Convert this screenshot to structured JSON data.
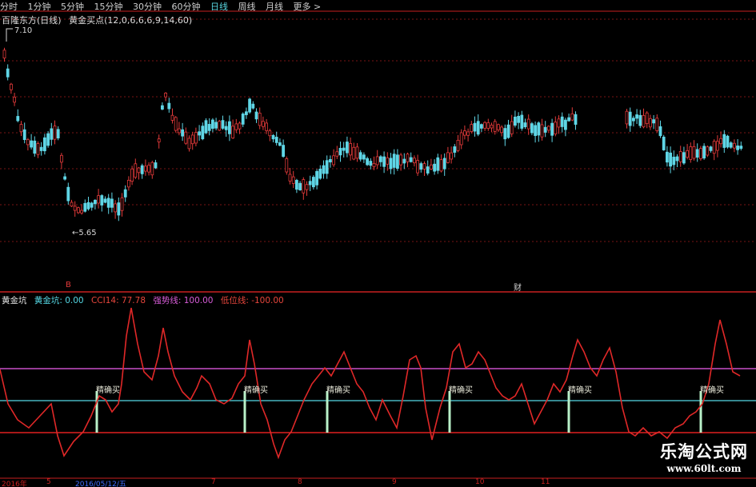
{
  "toolbar": {
    "items": [
      "分时",
      "1分钟",
      "5分钟",
      "15分钟",
      "30分钟",
      "60分钟",
      "日线",
      "周线",
      "月线",
      "更多 >"
    ],
    "active_index": 6
  },
  "main_chart": {
    "stock": "百隆东方(日线)",
    "indicator_title": "黄金买点(12,0,6,6,6,9,14,60)",
    "high_label": "7.10",
    "low_label": "←5.65",
    "markers": [
      "B",
      "财"
    ],
    "colors": {
      "up": "#e23a3a",
      "down": "#5fd6e6",
      "axis": "#c82020"
    }
  },
  "indicator_panel": {
    "name": "黄金坑",
    "values": [
      {
        "label": "黄金坑: 0.00",
        "color": "#55d9e6"
      },
      {
        "label": "CCI14: 77.78",
        "color": "#e8463c"
      },
      {
        "label": "强势线: 100.00",
        "color": "#d75cd8"
      },
      {
        "label": "低位线: -100.00",
        "color": "#e8463c"
      }
    ],
    "buy_signal_label": "精确买",
    "colors": {
      "cci": "#e02828",
      "strong": "#c850c8",
      "zero": "#55d9e6",
      "low": "#e02020",
      "signal": "#b8f0c8"
    }
  },
  "date_axis": {
    "labels": [
      "2016年",
      "5",
      "2016/05/12/五",
      "7",
      "8",
      "9",
      "10",
      "11"
    ]
  },
  "watermark": {
    "title": "乐淘公式网",
    "url": "www.60lt.com"
  }
}
